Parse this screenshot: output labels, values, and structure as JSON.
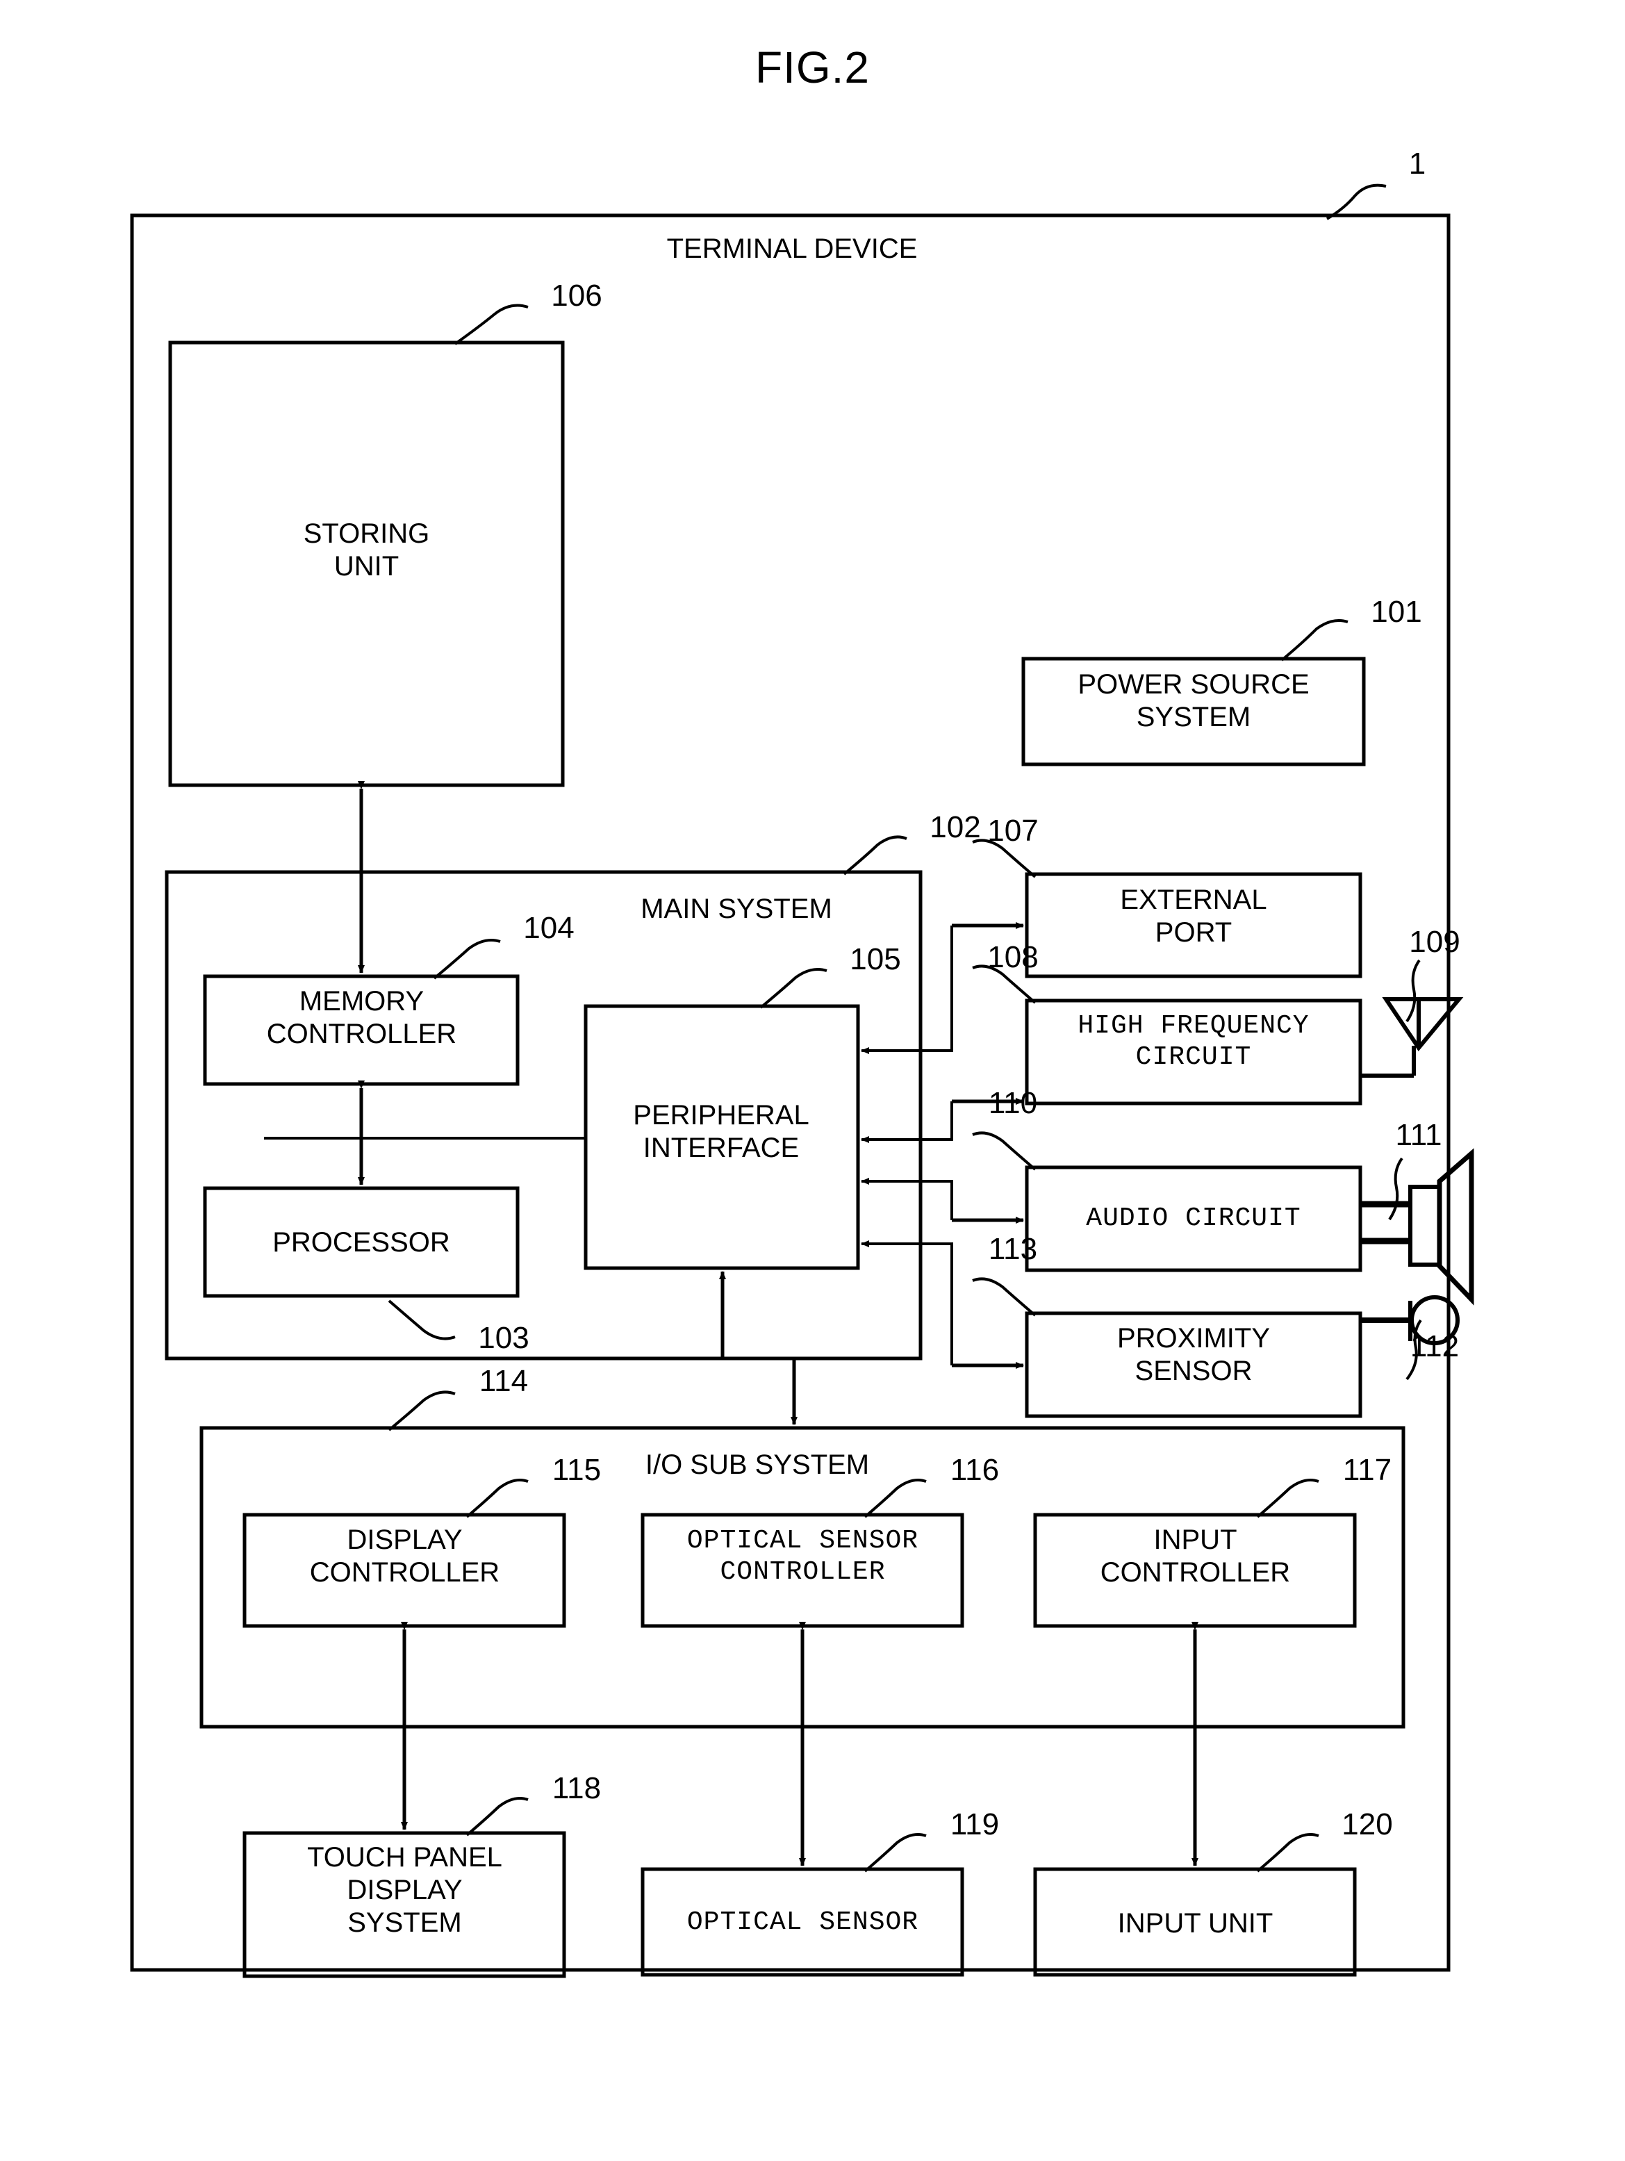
{
  "figure": {
    "title": "FIG.2",
    "outer_ref": "1",
    "outer_label": "TERMINAL DEVICE"
  },
  "blocks": {
    "storing_unit": {
      "ref": "106",
      "label": "STORING\nUNIT"
    },
    "power_source": {
      "ref": "101",
      "label": "POWER SOURCE\nSYSTEM"
    },
    "main_system": {
      "ref": "102",
      "label": "MAIN SYSTEM"
    },
    "memory_controller": {
      "ref": "104",
      "label": "MEMORY\nCONTROLLER"
    },
    "processor": {
      "ref": "103",
      "label": "PROCESSOR"
    },
    "peripheral_interface": {
      "ref": "105",
      "label": "PERIPHERAL\nINTERFACE"
    },
    "external_port": {
      "ref": "107",
      "label": "EXTERNAL\nPORT"
    },
    "high_frequency_circuit": {
      "ref": "108",
      "label": "HIGH FREQUENCY\nCIRCUIT"
    },
    "antenna": {
      "ref": "109",
      "label": ""
    },
    "audio_circuit": {
      "ref": "110",
      "label": "AUDIO CIRCUIT"
    },
    "speaker": {
      "ref": "111",
      "label": ""
    },
    "microphone": {
      "ref": "112",
      "label": ""
    },
    "proximity_sensor": {
      "ref": "113",
      "label": "PROXIMITY\nSENSOR"
    },
    "io_sub_system": {
      "ref": "114",
      "label": "I/O SUB SYSTEM"
    },
    "display_controller": {
      "ref": "115",
      "label": "DISPLAY\nCONTROLLER"
    },
    "optical_sensor_controller": {
      "ref": "116",
      "label": "OPTICAL SENSOR\nCONTROLLER"
    },
    "input_controller": {
      "ref": "117",
      "label": "INPUT\nCONTROLLER"
    },
    "touch_panel_display_system": {
      "ref": "118",
      "label": "TOUCH PANEL\nDISPLAY\nSYSTEM"
    },
    "optical_sensor": {
      "ref": "119",
      "label": "OPTICAL SENSOR"
    },
    "input_unit": {
      "ref": "120",
      "label": "INPUT UNIT"
    }
  },
  "colors": {
    "stroke": "#000000",
    "background": "#ffffff"
  }
}
